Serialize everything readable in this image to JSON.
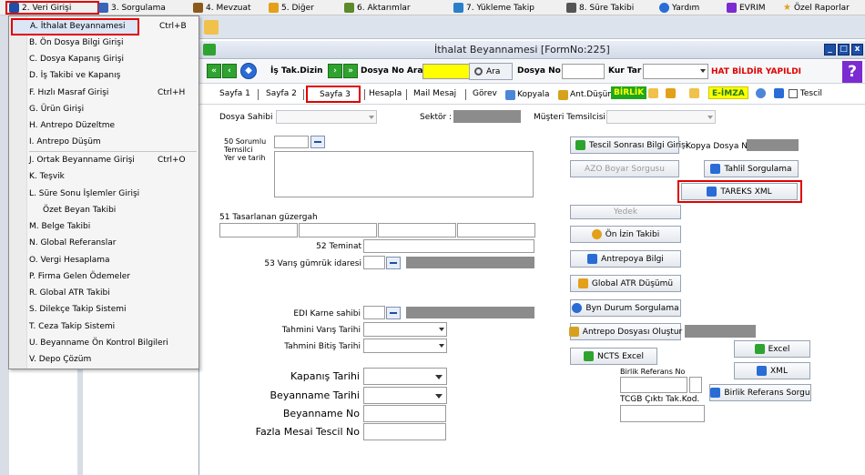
{
  "menubar": {
    "items": [
      {
        "label": "2. Veri Girişi",
        "icon": "data-entry-icon",
        "color": "#1d4fa6"
      },
      {
        "label": "3. Sorgulama",
        "icon": "query-icon",
        "color": "#3a64b7"
      },
      {
        "label": "4. Mevzuat",
        "icon": "legislation-icon",
        "color": "#8b5a1a"
      },
      {
        "label": "5. Diğer",
        "icon": "other-icon",
        "color": "#e3a019"
      },
      {
        "label": "6. Aktarımlar",
        "icon": "transfer-icon",
        "color": "#5a8a2a"
      },
      {
        "label": "7. Yükleme Takip",
        "icon": "upload-track-icon",
        "color": "#2a7fc9"
      },
      {
        "label": "8. Süre Takibi",
        "icon": "time-track-icon",
        "color": "#555555"
      },
      {
        "label": "Yardım",
        "icon": "help-icon",
        "color": "#2a6cd6"
      },
      {
        "label": "EVRIM",
        "icon": "evrim-icon",
        "color": "#7b2bd1"
      },
      {
        "label": "Özel Raporlar",
        "icon": "star-icon",
        "color": "#e3a019"
      }
    ]
  },
  "dropdown": {
    "items": [
      {
        "label": "A. İthalat Beyannamesi",
        "shortcut": "Ctrl+B",
        "highlighted": true
      },
      {
        "label": "B. Ön Dosya Bilgi Girişi",
        "shortcut": ""
      },
      {
        "label": "C. Dosya Kapanış Girişi",
        "shortcut": ""
      },
      {
        "label": "D. İş Takibi ve Kapanış",
        "shortcut": ""
      },
      {
        "label": "F. Hızlı Masraf Girişi",
        "shortcut": "Ctrl+H"
      },
      {
        "label": "G. Ürün Girişi",
        "shortcut": ""
      },
      {
        "label": "H. Antrepo Düzeltme",
        "shortcut": ""
      },
      {
        "label": "I. Antrepo Düşüm",
        "shortcut": ""
      },
      {
        "label": "J. Ortak Beyanname Girişi",
        "shortcut": "Ctrl+O"
      },
      {
        "label": "K. Teşvik",
        "shortcut": ""
      },
      {
        "label": "L. Süre Sonu İşlemler Girişi",
        "shortcut": ""
      },
      {
        "label": "Özet Beyan Takibi",
        "shortcut": ""
      },
      {
        "label": "M. Belge Takibi",
        "shortcut": ""
      },
      {
        "label": "N. Global Referanslar",
        "shortcut": ""
      },
      {
        "label": "O. Vergi Hesaplama",
        "shortcut": ""
      },
      {
        "label": "P. Firma Gelen Ödemeler",
        "shortcut": ""
      },
      {
        "label": "R. Global ATR Takibi",
        "shortcut": ""
      },
      {
        "label": "S. Dilekçe Takip Sistemi",
        "shortcut": ""
      },
      {
        "label": "T. Ceza Takip Sistemi",
        "shortcut": ""
      },
      {
        "label": "U. Beyanname Ön Kontrol Bilgileri",
        "shortcut": ""
      },
      {
        "label": "V. Depo Çözüm",
        "shortcut": ""
      }
    ]
  },
  "window": {
    "title": "İthalat Beyannamesi [FormNo:225]",
    "controls": {
      "minimize": "_",
      "maximize": "□",
      "close": "x"
    }
  },
  "nav": {
    "is_tak_dizin": "İş Tak.Dizin",
    "dosya_no_ara": "Dosya No Ara",
    "ara_btn": "Ara",
    "dosya_no": "Dosya No",
    "kur_tar": "Kur Tar",
    "hat_bildir": "HAT BİLDİR YAPILDI",
    "help": "?"
  },
  "tabs": {
    "sayfa1": "Sayfa 1",
    "sayfa2": "Sayfa 2",
    "sayfa3": "Sayfa 3",
    "hesapla": "Hesapla",
    "mail_mesaj": "Mail Mesaj",
    "gorev": "Görev",
    "kopyala": "Kopyala",
    "ant_dusum": "Ant.Düşüm",
    "birlik": "BİRLİK",
    "eimza": "E-İMZA",
    "tescil": "Tescil"
  },
  "form": {
    "dosya_sahibi": "Dosya Sahibi :",
    "sektor": "Sektör :",
    "musteri_temsilcisi": "Müşteri Temsilcisi :",
    "sorumlu_50": "50 Sorumlu",
    "temsilci": "Temsilci",
    "yer_tarih": "Yer ve tarih",
    "guzergah_51": "51 Tasarlanan güzergah",
    "teminat_52": "52 Teminat",
    "varis_53": "53 Varış gümrük idaresi",
    "edi_karne": "EDI Karne sahibi",
    "tahmini_varis": "Tahmini Varış Tarihi",
    "tahmini_bitis": "Tahmini Bitiş Tarihi",
    "kapanis": "Kapanış Tarihi",
    "beyanname_tarihi": "Beyanname Tarihi",
    "beyanname_no": "Beyanname No",
    "fazla_mesai": "Fazla Mesai Tescil No"
  },
  "buttons": {
    "tescil_sonrasi": "Tescil Sonrası Bilgi Girişi",
    "kopya_dosya_no": "Kopya Dosya No",
    "azo_boyar": "AZO Boyar Sorgusu",
    "tahlil": "Tahlil Sorgulama",
    "tareks": "TAREKS XML",
    "yedek": "Yedek",
    "on_izin": "Ön İzin Takibi",
    "antrepoya_bilgi": "Antrepoya Bilgi",
    "global_atr": "Global ATR Düşümü",
    "byn_durum": "Byn Durum Sorgulama",
    "antrepo_dosyasi": "Antrepo Dosyası Oluştur",
    "ncts_excel": "NCTS Excel",
    "excel": "Excel",
    "xml": "XML",
    "birlik_referans_no": "Birlik Referans No",
    "birlik_referans_sorgu": "Birlik Referans Sorgu",
    "tcgb_cikti": "TCGB Çıktı Tak.Kod."
  },
  "colors": {
    "highlight_red": "#e00000",
    "nav_green": "#2fa32f",
    "yellow_input": "#ffff00",
    "disabled_gray": "#8c8c8c"
  }
}
